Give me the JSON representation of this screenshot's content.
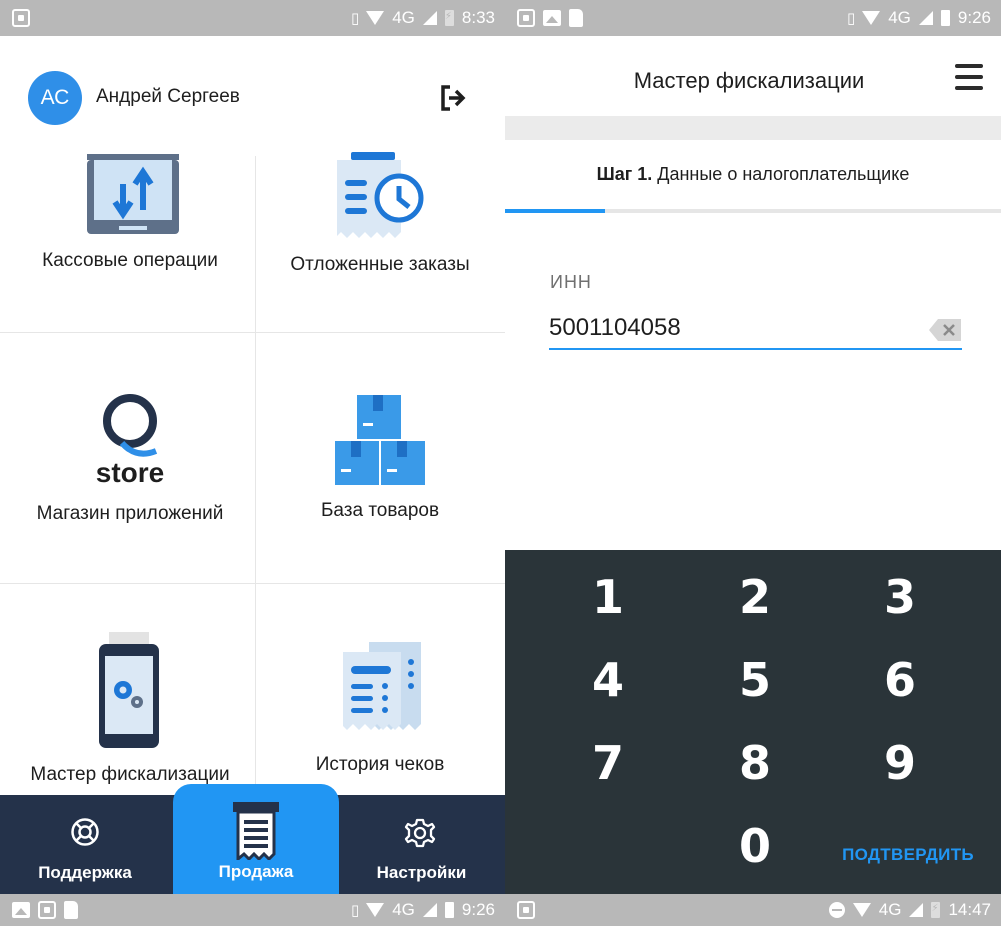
{
  "left": {
    "status_top": {
      "time": "8:33",
      "network": "4G"
    },
    "user": {
      "initials": "АС",
      "name": "Андрей Сергеев"
    },
    "tiles": [
      {
        "label": "Кассовые операции",
        "icon": "cash-operations-icon"
      },
      {
        "label": "Отложенные заказы",
        "icon": "deferred-orders-icon"
      },
      {
        "label": "Магазин приложений",
        "icon": "qstore-logo",
        "logo_text": "store"
      },
      {
        "label": "База товаров",
        "icon": "boxes-icon"
      },
      {
        "label": "Мастер фискализации",
        "icon": "fiscal-terminal-icon"
      },
      {
        "label": "История чеков",
        "icon": "receipts-history-icon"
      }
    ],
    "bottom_nav": {
      "support": "Поддержка",
      "sale": "Продажа",
      "settings": "Настройки"
    },
    "status_bottom": {
      "time": "9:26",
      "network": "4G"
    }
  },
  "right": {
    "status_top": {
      "time": "9:26",
      "network": "4G"
    },
    "title": "Мастер фискализации",
    "step_prefix": "Шаг 1.",
    "step_text": " Данные о налогоплательщике",
    "inn_label": "ИНН",
    "inn_value": "5001104058",
    "keys": [
      "1",
      "2",
      "3",
      "4",
      "5",
      "6",
      "7",
      "8",
      "9",
      "0"
    ],
    "confirm_label": "ПОДТВЕРДИТЬ",
    "status_bottom": {
      "time": "14:47",
      "network": "4G"
    }
  },
  "colors": {
    "accent": "#2196f3",
    "nav_bg": "#24324a",
    "keypad_bg": "#2a3439",
    "status_bg": "#b8b8b8"
  }
}
